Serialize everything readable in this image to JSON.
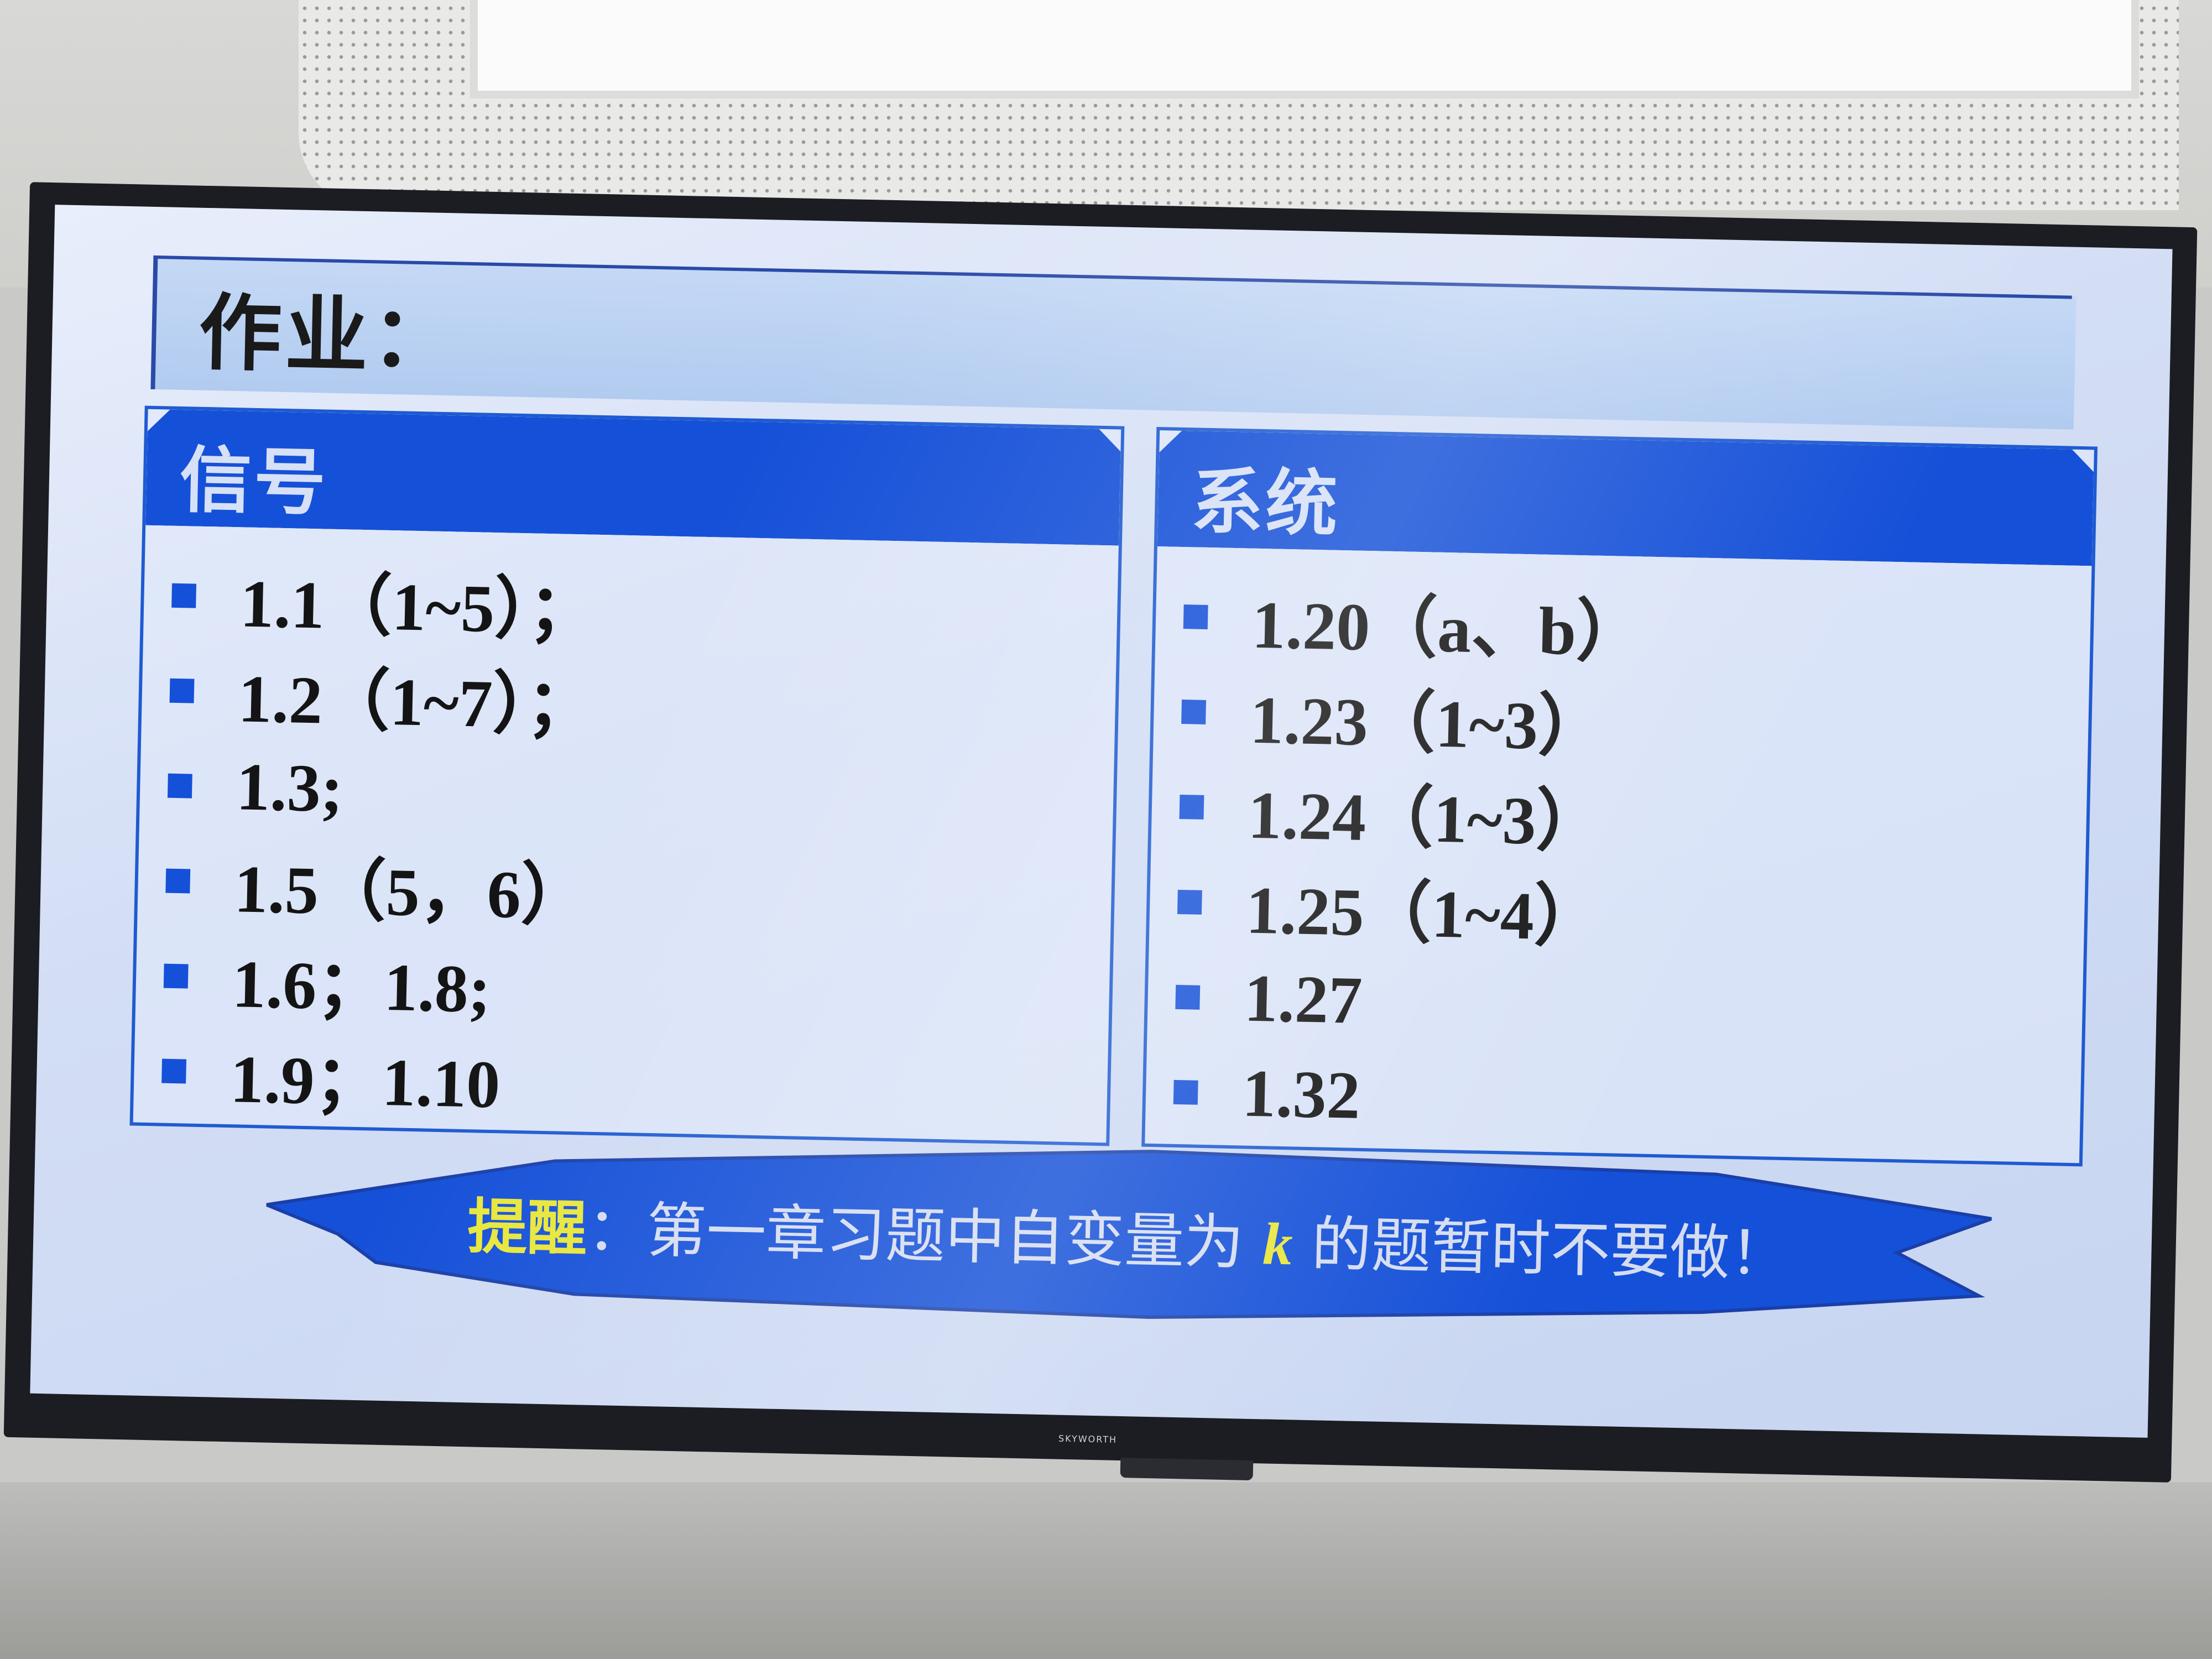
{
  "slide": {
    "title": "作业：",
    "panels": [
      {
        "heading": "信号",
        "items": [
          "1.1（1~5）；",
          "1.2（1~7）；",
          "1.3;",
          "1.5（5，6）",
          "1.6；1.8;",
          "1.9；1.10"
        ]
      },
      {
        "heading": "系统",
        "items": [
          "1.20（a、b）",
          "1.23（1~3）",
          "1.24（1~3）",
          "1.25（1~4）",
          "1.27",
          "1.32"
        ]
      }
    ],
    "reminder": {
      "label": "提醒",
      "colon": "：",
      "body_before": "第一章习题中自变量为 ",
      "variable": "k",
      "body_after": " 的题暂时不要做！"
    }
  },
  "tv": {
    "brand": "SKYWORTH"
  },
  "colors": {
    "accent_blue": "#1550d8",
    "highlight_yellow": "#e8e63a",
    "screen_background": "#d3def5"
  },
  "icons": {
    "bullet": "blue-square-bullet-icon"
  }
}
